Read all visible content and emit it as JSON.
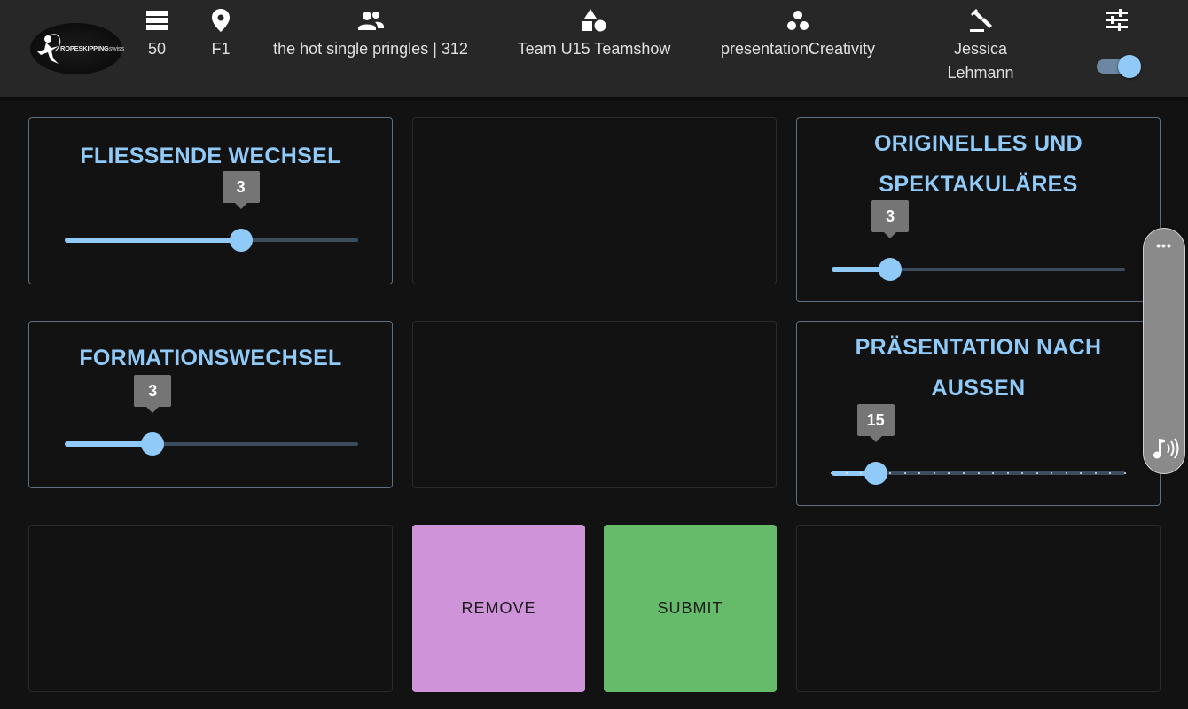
{
  "header": {
    "logo": {
      "brand_bold": "ROPESKIPPING",
      "brand_light": "swiss"
    },
    "heat": {
      "icon": "list-icon",
      "value": "50"
    },
    "field": {
      "icon": "location-pin-icon",
      "value": "F1"
    },
    "participant": {
      "icon": "group-icon",
      "value": "the hot single pringles | 312"
    },
    "team": {
      "icon": "shapes-icon",
      "value": "Team U15 Teamshow"
    },
    "category": {
      "icon": "bubble-chart-icon",
      "value": "presentationCreativity"
    },
    "judge": {
      "icon": "gavel-icon",
      "first_name": "Jessica",
      "last_name": "Lehmann"
    },
    "settings": {
      "icon": "tune-icon",
      "toggle_on": true
    }
  },
  "scores": {
    "fliessende_wechsel": {
      "title": "FLIESSENDE WECHSEL",
      "value": "3",
      "fraction": 0.6
    },
    "originelles": {
      "title_line1": "ORIGINELLES UND",
      "title_line2": "SPEKTAKULÄRES",
      "value": "3",
      "fraction": 0.2
    },
    "formationswechsel": {
      "title": "FORMATIONSWECHSEL",
      "value": "3",
      "fraction": 0.3
    },
    "praesentation": {
      "title_line1": "PRÄSENTATION NACH",
      "title_line2": "AUSSEN",
      "value": "15",
      "fraction": 0.15,
      "steps": 20
    }
  },
  "actions": {
    "remove_label": "REMOVE",
    "submit_label": "SUBMIT"
  },
  "side_panel": {
    "menu_icon": "more-horizontal-icon",
    "audio_icon": "audio-note-icon"
  },
  "colors": {
    "accent": "#90caf9",
    "remove": "#ce93d8",
    "submit": "#66bb6a",
    "topbar": "#272727",
    "background": "#121212"
  }
}
